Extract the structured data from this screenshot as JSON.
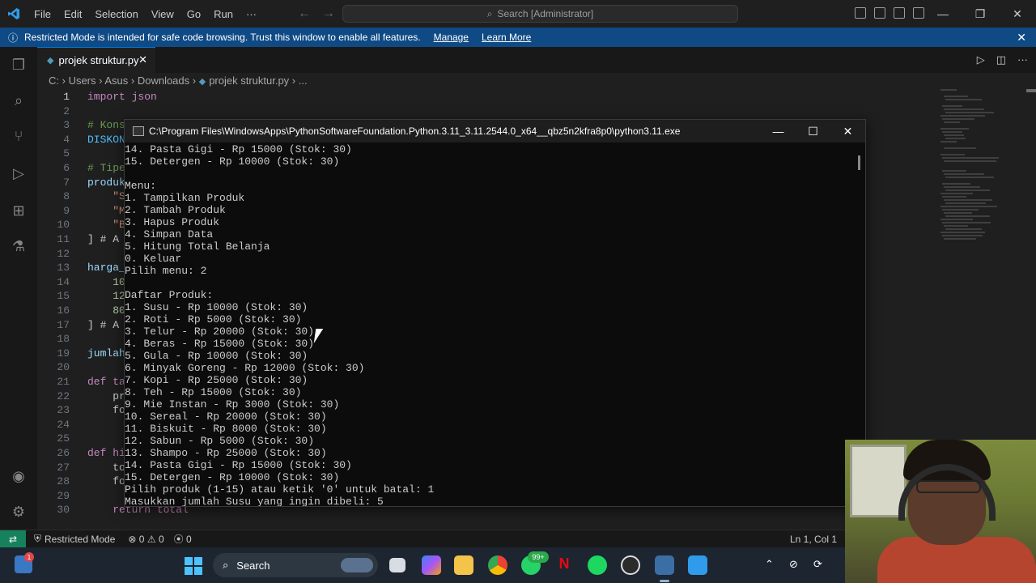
{
  "titlebar": {
    "menu": [
      "File",
      "Edit",
      "Selection",
      "View",
      "Go",
      "Run",
      "···"
    ],
    "search_text": "Search [Administrator]"
  },
  "banner": {
    "message": "Restricted Mode is intended for safe code browsing. Trust this window to enable all features.",
    "manage_label": "Manage",
    "learn_more_label": "Learn More"
  },
  "tab": {
    "label": "projek struktur.py"
  },
  "breadcrumb": [
    "C:",
    "Users",
    "Asus",
    "Downloads",
    "projek struktur.py",
    "..."
  ],
  "editor": {
    "line_numbers": [
      "1",
      "2",
      "3",
      "4",
      "5",
      "6",
      "7",
      "8",
      "9",
      "10",
      "11",
      "12",
      "13",
      "14",
      "15",
      "16",
      "17",
      "18",
      "19",
      "20",
      "21",
      "22",
      "23",
      "24",
      "25",
      "26",
      "27",
      "28",
      "29",
      "30"
    ],
    "lines": [
      "import json",
      "",
      "# Kons",
      "DISKON",
      "",
      "# Tipe",
      "produk",
      "    \"S",
      "    \"M",
      "    \"B",
      "] # A",
      "",
      "harga_",
      "    10",
      "    12",
      "    80",
      "] # A",
      "",
      "jumlah",
      "",
      "def ta",
      "    pr",
      "    fo",
      "",
      "",
      "def hi",
      "    to",
      "    fo",
      "",
      "    return total"
    ]
  },
  "console": {
    "title": "C:\\Program Files\\WindowsApps\\PythonSoftwareFoundation.Python.3.11_3.11.2544.0_x64__qbz5n2kfra8p0\\python3.11.exe",
    "lines": [
      "14. Pasta Gigi - Rp 15000 (Stok: 30)",
      "15. Detergen - Rp 10000 (Stok: 30)",
      "",
      "Menu:",
      "1. Tampilkan Produk",
      "2. Tambah Produk",
      "3. Hapus Produk",
      "4. Simpan Data",
      "5. Hitung Total Belanja",
      "0. Keluar",
      "Pilih menu: 2",
      "",
      "Daftar Produk:",
      "1. Susu - Rp 10000 (Stok: 30)",
      "2. Roti - Rp 5000 (Stok: 30)",
      "3. Telur - Rp 20000 (Stok: 30)",
      "4. Beras - Rp 15000 (Stok: 30)",
      "5. Gula - Rp 10000 (Stok: 30)",
      "6. Minyak Goreng - Rp 12000 (Stok: 30)",
      "7. Kopi - Rp 25000 (Stok: 30)",
      "8. Teh - Rp 15000 (Stok: 30)",
      "9. Mie Instan - Rp 3000 (Stok: 30)",
      "10. Sereal - Rp 20000 (Stok: 30)",
      "11. Biskuit - Rp 8000 (Stok: 30)",
      "12. Sabun - Rp 5000 (Stok: 30)",
      "13. Shampo - Rp 25000 (Stok: 30)",
      "14. Pasta Gigi - Rp 15000 (Stok: 30)",
      "15. Detergen - Rp 10000 (Stok: 30)",
      "Pilih produk (1-15) atau ketik '0' untuk batal: 1",
      "Masukkan jumlah Susu yang ingin dibeli: 5"
    ]
  },
  "statusbar": {
    "restricted_label": "Restricted Mode",
    "errors": "0",
    "warnings": "0",
    "ports": "0",
    "position": "Ln 1, Col 1"
  },
  "taskbar": {
    "search_label": "Search",
    "weather_badge": "1",
    "whatsapp_badge": "99+"
  },
  "colors": {
    "accent": "#0078d4",
    "banner": "#0f4a85",
    "remote": "#16825d"
  }
}
